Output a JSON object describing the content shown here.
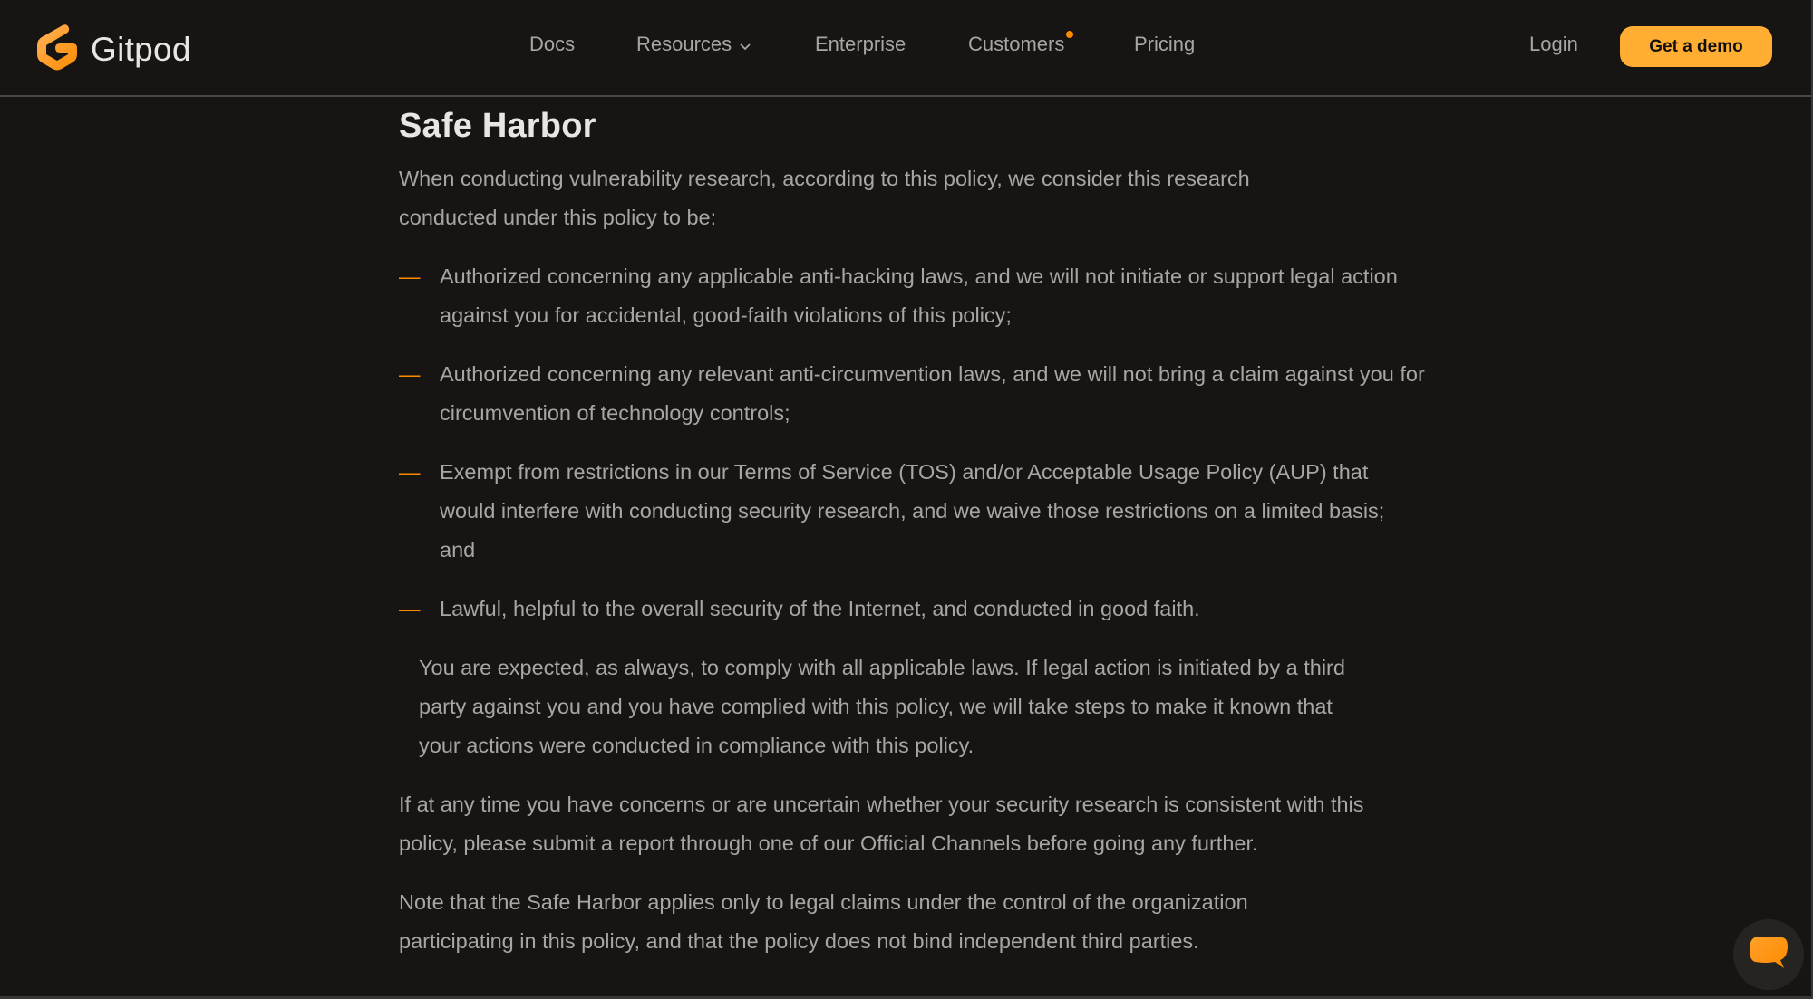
{
  "nav": {
    "brand": "Gitpod",
    "links": [
      {
        "label": "Docs"
      },
      {
        "label": "Resources",
        "has_dropdown": true
      },
      {
        "label": "Enterprise"
      },
      {
        "label": "Customers",
        "has_badge": true
      },
      {
        "label": "Pricing"
      }
    ],
    "login": "Login",
    "cta": "Get a demo"
  },
  "colors": {
    "accent": "#ff8a00",
    "cta_bg": "#ffae33",
    "background": "#161513",
    "heading": "#e8e6e2",
    "body_text": "#a8a6a1"
  },
  "content": {
    "heading": "Safe Harbor",
    "intro": "When conducting vulnerability research, according to this policy, we consider this research conducted under this policy to be:",
    "bullets": [
      "Authorized concerning any applicable anti-hacking laws, and we will not initiate or support legal action against you for accidental, good-faith violations of this policy;",
      "Authorized concerning any relevant anti-circumvention laws, and we will not bring a claim against you for circumvention of technology controls;",
      "Exempt from restrictions in our Terms of Service (TOS) and/or Acceptable Usage Policy (AUP) that would interfere with conducting security research, and we waive those restrictions on a limited basis; and",
      "Lawful, helpful to the overall security of the Internet, and conducted in good faith."
    ],
    "bullet_marker": "—",
    "indented_paragraph": "You are expected, as always, to comply with all applicable laws. If legal action is initiated by a third party against you and you have complied with this policy, we will take steps to make it known that your actions were conducted in compliance with this policy.",
    "paragraphs": [
      "If at any time you have concerns or are uncertain whether your security research is consistent with this policy, please submit a report through one of our Official Channels before going any further.",
      "Note that the Safe Harbor applies only to legal claims under the control of the organization participating in this policy, and that the policy does not bind independent third parties."
    ]
  },
  "chat": {
    "icon": "chat-bubble-icon"
  }
}
